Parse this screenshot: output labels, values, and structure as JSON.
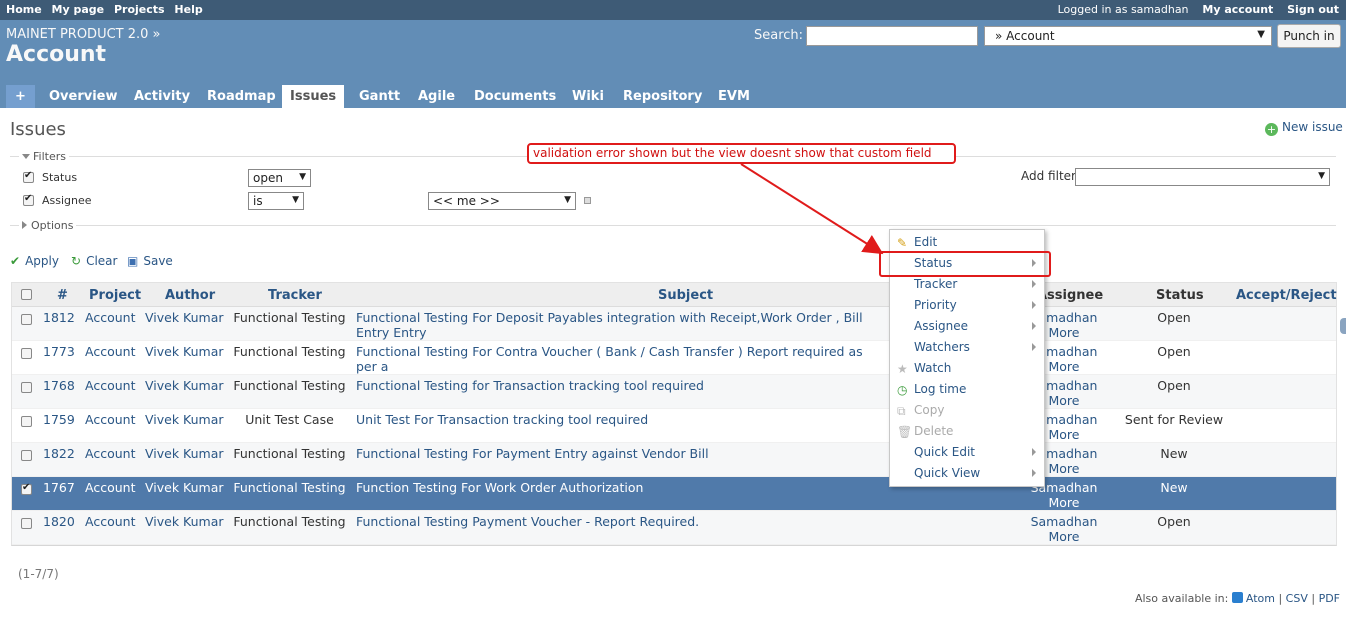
{
  "top_menu": {
    "left": [
      "Home",
      "My page",
      "Projects",
      "Help"
    ],
    "logged_in_prefix": "Logged in as",
    "user": "samadhan",
    "my_account": "My account",
    "sign_out": "Sign out"
  },
  "header": {
    "parent_project": "MAINET PRODUCT 2.0 »",
    "project_title": "Account",
    "search_label": "Search:",
    "search_value": "",
    "project_jump": "» Account",
    "punch_button": "Punch in"
  },
  "main_menu": {
    "plus": "+",
    "tabs": [
      "Overview",
      "Activity",
      "Roadmap",
      "Issues",
      "Gantt",
      "Agile",
      "Documents",
      "Wiki",
      "Repository",
      "EVM"
    ],
    "selected": "Issues"
  },
  "page": {
    "title": "Issues",
    "new_issue": "New issue"
  },
  "filters": {
    "legend": "Filters",
    "status_label": "Status",
    "status_operator": "open",
    "assignee_label": "Assignee",
    "assignee_operator": "is",
    "assignee_value": "<< me >>",
    "add_filter_label": "Add filter",
    "add_filter_value": "",
    "options_legend": "Options"
  },
  "actions": {
    "apply": "Apply",
    "clear": "Clear",
    "save": "Save"
  },
  "table": {
    "headers": {
      "id": "#",
      "project": "Project",
      "author": "Author",
      "tracker": "Tracker",
      "subject": "Subject",
      "assignee": "Assignee",
      "status": "Status",
      "accept_reject": "Accept/Reject"
    },
    "rows": [
      {
        "id": "1812",
        "project": "Account",
        "author": "Vivek Kumar",
        "tracker": "Functional Testing",
        "subject": "Functional Testing For Deposit Payables integration with Receipt,Work Order , Bill Entry Entry",
        "assignee_name": "Samadhan",
        "assignee_more": "More",
        "status": "Open",
        "checked": false
      },
      {
        "id": "1773",
        "project": "Account",
        "author": "Vivek Kumar",
        "tracker": "Functional Testing",
        "subject": "Functional Testing For Contra Voucher ( Bank / Cash Transfer ) Report required as per a",
        "assignee_name": "Samadhan",
        "assignee_more": "More",
        "status": "Open",
        "checked": false
      },
      {
        "id": "1768",
        "project": "Account",
        "author": "Vivek Kumar",
        "tracker": "Functional Testing",
        "subject": "Functional Testing for Transaction tracking tool required",
        "assignee_name": "Samadhan",
        "assignee_more": "More",
        "status": "Open",
        "checked": false
      },
      {
        "id": "1759",
        "project": "Account",
        "author": "Vivek Kumar",
        "tracker": "Unit Test Case",
        "subject": "Unit Test For Transaction tracking tool required",
        "assignee_name": "Samadhan",
        "assignee_more": "More",
        "status": "Sent for Review",
        "checked": false
      },
      {
        "id": "1822",
        "project": "Account",
        "author": "Vivek Kumar",
        "tracker": "Functional Testing",
        "subject": "Functional Testing For Payment Entry against Vendor Bill",
        "assignee_name": "Samadhan",
        "assignee_more": "More",
        "status": "New",
        "checked": false
      },
      {
        "id": "1767",
        "project": "Account",
        "author": "Vivek Kumar",
        "tracker": "Functional Testing",
        "subject": "Function Testing For Work Order Authorization",
        "assignee_name": "Samadhan",
        "assignee_more": "More",
        "status": "New",
        "checked": true
      },
      {
        "id": "1820",
        "project": "Account",
        "author": "Vivek Kumar",
        "tracker": "Functional Testing",
        "subject": "Functional Testing Payment Voucher - Report Required.",
        "assignee_name": "Samadhan",
        "assignee_more": "More",
        "status": "Open",
        "checked": false
      }
    ]
  },
  "pagination": "(1-7/7)",
  "other_formats": {
    "label": "Also available in:",
    "atom": "Atom",
    "csv": "CSV",
    "pdf": "PDF"
  },
  "context_menu": {
    "items": [
      {
        "label": "Edit",
        "icon": "pencil-icon",
        "submenu": false,
        "disabled": false
      },
      {
        "label": "Status",
        "icon": "",
        "submenu": true,
        "disabled": false
      },
      {
        "label": "Tracker",
        "icon": "",
        "submenu": true,
        "disabled": false
      },
      {
        "label": "Priority",
        "icon": "",
        "submenu": true,
        "disabled": false
      },
      {
        "label": "Assignee",
        "icon": "",
        "submenu": true,
        "disabled": false
      },
      {
        "label": "Watchers",
        "icon": "",
        "submenu": true,
        "disabled": false
      },
      {
        "label": "Watch",
        "icon": "star-icon",
        "submenu": false,
        "disabled": false
      },
      {
        "label": "Log time",
        "icon": "clock-icon",
        "submenu": false,
        "disabled": false
      },
      {
        "label": "Copy",
        "icon": "copy-icon",
        "submenu": false,
        "disabled": true
      },
      {
        "label": "Delete",
        "icon": "trash-icon",
        "submenu": false,
        "disabled": true
      },
      {
        "label": "Quick Edit",
        "icon": "",
        "submenu": true,
        "disabled": false
      },
      {
        "label": "Quick View",
        "icon": "",
        "submenu": true,
        "disabled": false
      }
    ]
  },
  "annotation": {
    "text": "validation error shown but the view doesnt show that custom field",
    "color": "#e01b1b"
  },
  "colors": {
    "header": "#628db6",
    "top_menu": "#3e5b76",
    "selected_row": "#507aaa",
    "link": "#2a5685"
  }
}
